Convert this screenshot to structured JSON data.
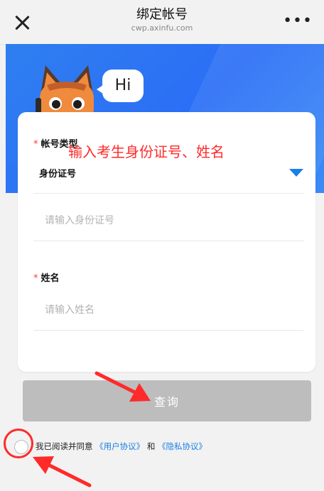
{
  "header": {
    "title": "绑定帐号",
    "subtitle": "cwp.axinfu.com",
    "close_icon": "close-icon",
    "more_icon": "more-dots-icon",
    "more_glyph": "•••"
  },
  "banner": {
    "greeting": "Hi",
    "colors": {
      "start": "#2f7ff0",
      "end": "#3a8cf5"
    }
  },
  "form": {
    "account_type_label": "帐号类型",
    "account_type_value": "身份证号",
    "required_mark": "*",
    "id_placeholder": "请输入身份证号",
    "name_label": "姓名",
    "name_placeholder": "请输入姓名"
  },
  "annotation_text": "输入考生身份证号、姓名",
  "query_button": "查询",
  "agreement": {
    "prefix": "我已阅读并同意",
    "user_link": "《用户协议》",
    "and": "和",
    "privacy_link": "《隐私协议》"
  },
  "colors": {
    "accent": "#1a7fe6",
    "annotation": "#ff2a2a",
    "required": "#ff3b30",
    "disabled_button": "#bdbdbd"
  }
}
